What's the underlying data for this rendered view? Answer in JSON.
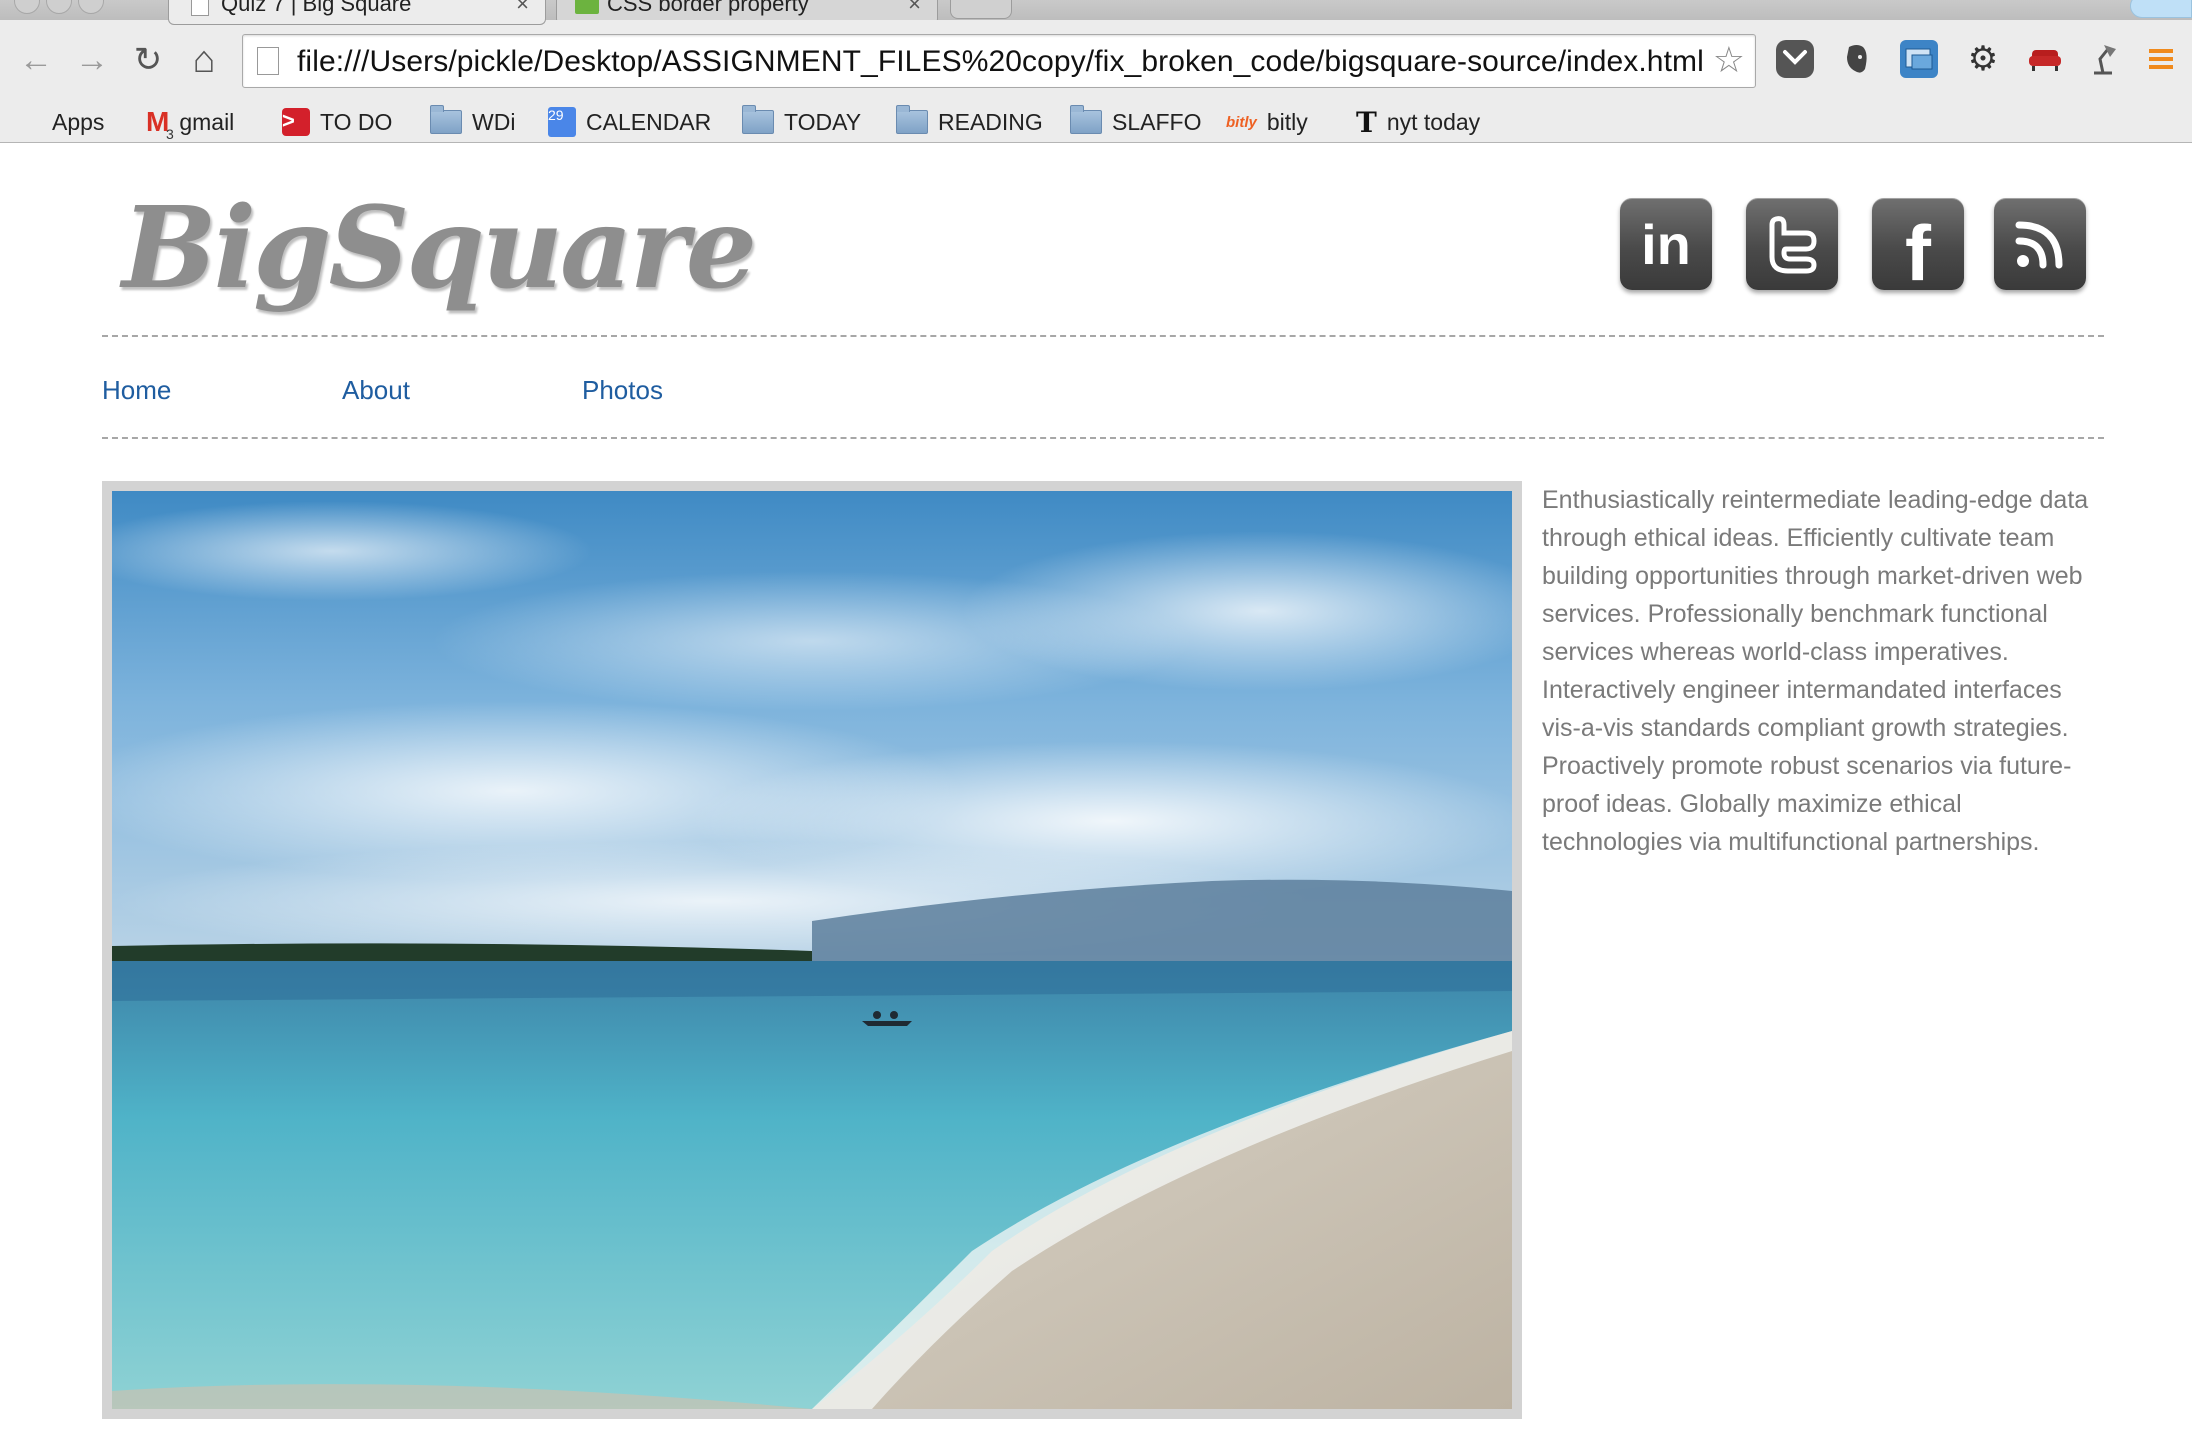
{
  "browser": {
    "tabs": [
      {
        "title": "Quiz 7 | Big Square",
        "close": "×"
      },
      {
        "title": "CSS border property",
        "close": "×"
      }
    ],
    "omnibox": {
      "url": "file:///Users/pickle/Desktop/ASSIGNMENT_FILES%20copy/fix_broken_code/bigsquare-source/index.html",
      "star": "☆"
    },
    "nav_icons": {
      "back": "←",
      "forward": "→",
      "reload": "↻",
      "home": "⌂"
    },
    "extensions": [
      "pocket-icon",
      "evernote-icon",
      "screenshot-icon",
      "settings-gear-icon",
      "couch-icon",
      "lamp-icon",
      "menu-icon"
    ],
    "bookmarks": [
      {
        "label": "Apps",
        "icon": "apps-grid-icon"
      },
      {
        "label": "gmail",
        "icon": "gmail-icon",
        "badge": "3"
      },
      {
        "label": "TO DO",
        "icon": "todo-chevron-icon"
      },
      {
        "label": "WDi",
        "icon": "folder-icon"
      },
      {
        "label": "CALENDAR",
        "icon": "calendar-icon",
        "badge": "29"
      },
      {
        "label": "TODAY",
        "icon": "folder-icon"
      },
      {
        "label": "READING",
        "icon": "folder-icon"
      },
      {
        "label": "SLAFFO",
        "icon": "folder-icon"
      },
      {
        "label": "bitly",
        "icon": "bitly-icon",
        "badge": "bitly"
      },
      {
        "label": "nyt today",
        "icon": "nyt-icon",
        "badge": "T"
      }
    ]
  },
  "site": {
    "logo": "BigSquare",
    "social": [
      {
        "name": "linkedin",
        "glyph": "in"
      },
      {
        "name": "twitter",
        "glyph": "t"
      },
      {
        "name": "facebook",
        "glyph": "f"
      },
      {
        "name": "rss",
        "glyph": ""
      }
    ],
    "nav": [
      "Home",
      "About",
      "Photos"
    ],
    "body": "Enthusiastically reintermediate leading-edge data through ethical ideas. Efficiently cultivate team building opportunities through market-driven web services. Professionally benchmark functional services whereas world-class imperatives. Interactively engineer intermandated interfaces vis-a-vis standards compliant growth strategies. Proactively promote robust scenarios via future-proof ideas. Globally maximize ethical technologies via multifunctional partnerships."
  },
  "colors": {
    "link": "#1f5da0",
    "text": "#7a7a7a",
    "logo": "#8e8e8e",
    "frame": "#d3d3d3"
  }
}
